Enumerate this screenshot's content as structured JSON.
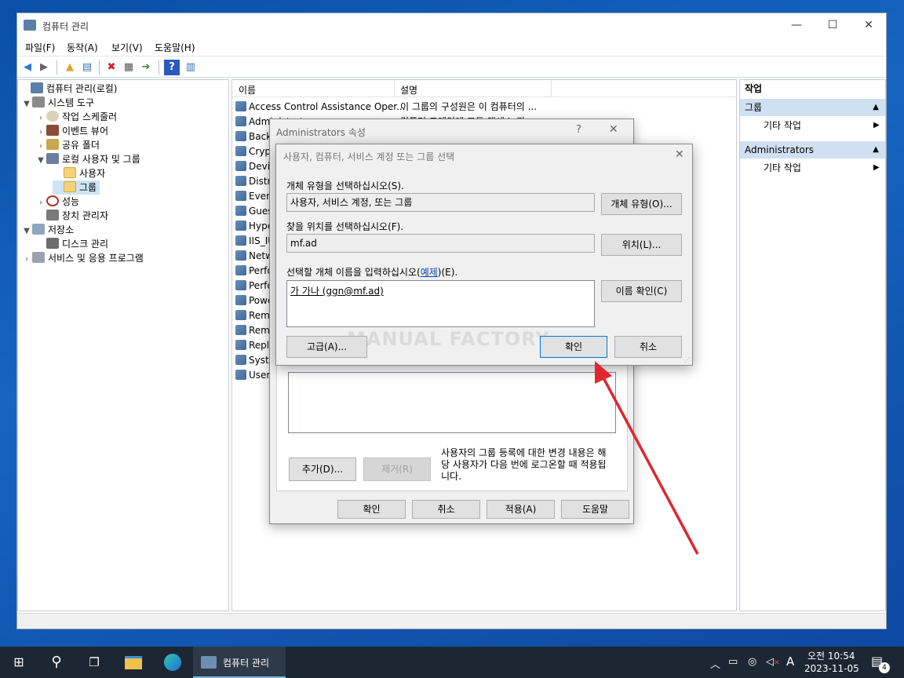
{
  "window": {
    "title": "컴퓨터 관리",
    "minimize": "—",
    "maximize": "☐",
    "close": "✕"
  },
  "menu": [
    "파일(F)",
    "동작(A)",
    "보기(V)",
    "도움말(H)"
  ],
  "toolbar_icons": [
    "back-icon",
    "forward-icon",
    "up-folder-icon",
    "show-hide-tree-icon",
    "delete-icon",
    "properties-icon",
    "export-icon",
    "help-icon",
    "show-hide-action-pane-icon"
  ],
  "tree": {
    "root": "컴퓨터 관리(로컬)",
    "system_tools": "시스템 도구",
    "task_scheduler": "작업 스케줄러",
    "event_viewer": "이벤트 뷰어",
    "shared_folders": "공유 폴더",
    "local_users_groups": "로컬 사용자 및 그룹",
    "users": "사용자",
    "groups": "그룹",
    "performance": "성능",
    "device_manager": "장치 관리자",
    "storage": "저장소",
    "disk_management": "디스크 관리",
    "services_apps": "서비스 및 응용 프로그램"
  },
  "list": {
    "col_name": "이름",
    "col_desc": "설명",
    "rows": [
      {
        "name": "Access Control Assistance Oper...",
        "desc": "이 그룹의 구성원은 이 컴퓨터의 ..."
      },
      {
        "name": "Administrators",
        "desc": "컴퓨터 도메인에 모든 액세스 권..."
      },
      {
        "name": "Backup Operators",
        "desc": ""
      },
      {
        "name": "Cryptographic Operators",
        "desc": ""
      },
      {
        "name": "Device Owners",
        "desc": ""
      },
      {
        "name": "Distributed COM Users",
        "desc": ""
      },
      {
        "name": "Event Log Readers",
        "desc": ""
      },
      {
        "name": "Guests",
        "desc": ""
      },
      {
        "name": "Hyper-V Administrators",
        "desc": ""
      },
      {
        "name": "IIS_IUSRS",
        "desc": ""
      },
      {
        "name": "Network Configuration Operators",
        "desc": ""
      },
      {
        "name": "Performance Log Users",
        "desc": ""
      },
      {
        "name": "Performance Monitor Users",
        "desc": ""
      },
      {
        "name": "Power Users",
        "desc": ""
      },
      {
        "name": "Remote Desktop Users",
        "desc": ""
      },
      {
        "name": "Remote Management Users",
        "desc": ""
      },
      {
        "name": "Replicator",
        "desc": ""
      },
      {
        "name": "System Managed Accounts Group",
        "desc": ""
      },
      {
        "name": "Users",
        "desc": ""
      }
    ]
  },
  "actions": {
    "header": "작업",
    "sec1": "그룹",
    "sec1_item": "기타 작업",
    "sec2": "Administrators",
    "sec2_item": "기타 작업"
  },
  "props_dialog": {
    "title": "Administrators 속성",
    "help": "?",
    "close": "✕",
    "add": "추가(D)...",
    "remove": "제거(R)",
    "note": "사용자의 그룹 등록에 대한 변경 내용은 해당 사용자가 다음 번에 로그온할 때 적용됩니다.",
    "ok": "확인",
    "cancel": "취소",
    "apply": "적용(A)",
    "helpbtn": "도움말"
  },
  "select_dialog": {
    "title": "사용자, 컴퓨터, 서비스 계정 또는 그룹 선택",
    "close": "✕",
    "type_label": "개체 유형을 선택하십시오(S).",
    "type_value": "사용자, 서비스 계정, 또는 그룹",
    "type_button": "개체 유형(O)...",
    "loc_label": "찾을 위치를 선택하십시오(F).",
    "loc_value": "mf.ad",
    "loc_button": "위치(L)...",
    "name_label_pre": "선택할 개체 이름을 입력하십시오(",
    "name_label_link": "예제",
    "name_label_post": ")(E).",
    "name_value": "가 가나 (ggn@mf.ad)",
    "check_button": "이름 확인(C)",
    "advanced": "고급(A)...",
    "ok": "확인",
    "cancel": "취소"
  },
  "watermark": "MANUAL FACTORY",
  "annotation_color": "#e0262f",
  "taskbar": {
    "app_label": "컴퓨터 관리",
    "ime": "A",
    "time": "오전 10:54",
    "date": "2023-11-05",
    "notifications": "4"
  }
}
